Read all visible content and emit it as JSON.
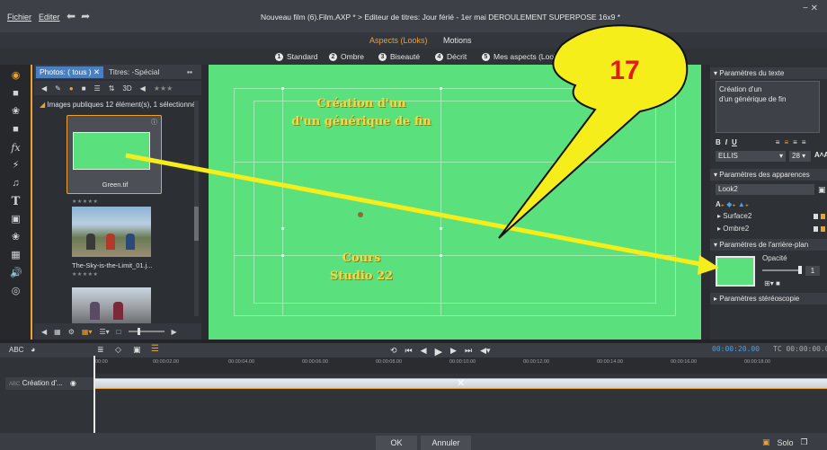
{
  "menu": {
    "file": "Fichier",
    "edit": "Editer"
  },
  "window_title": "Nouveau film (6).Film.AXP * > Editeur de titres: Jour férié - 1er mai DEROULEMENT SUPERPOSE 16x9 *",
  "top_tabs": {
    "looks": "Aspects (Looks)",
    "motions": "Motions"
  },
  "looks": [
    {
      "num": "1",
      "label": "Standard"
    },
    {
      "num": "2",
      "label": "Ombre"
    },
    {
      "num": "3",
      "label": "Biseauté"
    },
    {
      "num": "4",
      "label": "Décrit"
    },
    {
      "num": "5",
      "label": "Mes aspects (Looks)"
    }
  ],
  "library": {
    "tab_active": "Photos: ( tous )",
    "tab_other": "Titres: -Spécial",
    "header": "Images publiques  12 élément(s), 1 sélectionné",
    "items": [
      {
        "label": "Green.tif",
        "rating": "★★★★★"
      },
      {
        "label": "The-Sky-is-the-Limit_01.j...",
        "rating": "★★★★★"
      }
    ]
  },
  "preview": {
    "title_line1": "Création d'un",
    "title_line2": "d'un générique de fin",
    "sub_line1": "Cours",
    "sub_line2": "Studio 22",
    "bg_color": "#5ae07d",
    "text_color": "#f3d84a"
  },
  "callout": {
    "number": "17"
  },
  "right_panel": {
    "text_params": "Paramètres du texte",
    "text_content_1": "Création d'un",
    "text_content_2": "d'un générique de fin",
    "font": "ELLIS",
    "font_size": "28",
    "appearance_params": "Paramètres des apparences",
    "look_name": "Look2",
    "surface": "Surface2",
    "shadow": "Ombre2",
    "bg_params": "Paramètres de l'arrière-plan",
    "opacity_label": "Opacité",
    "opacity_value": "1",
    "stereo_params": "Paramètres stéréoscopie"
  },
  "timeline": {
    "timecode_duration": "00:00:20.00",
    "timecode_tc": "TC 00:00:00.00",
    "ticks": [
      "00:00",
      "00:00:02.00",
      "00:00:04.00",
      "00:00:06.00",
      "00:00:08.00",
      "00:00:10.00",
      "00:00:12.00",
      "00:00:14.00",
      "00:00:16.00",
      "00:00:18.00"
    ],
    "track_label": "Création d'..."
  },
  "footer": {
    "ok": "OK",
    "cancel": "Annuler",
    "solo": "Solo"
  }
}
